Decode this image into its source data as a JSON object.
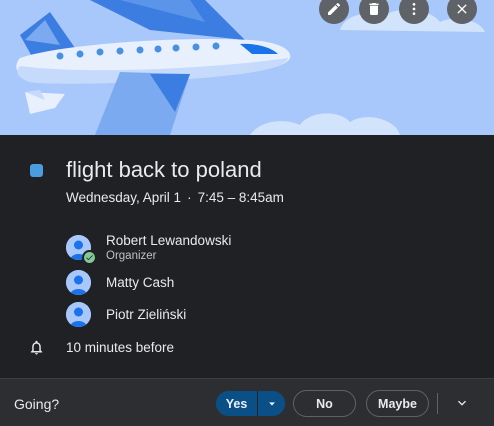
{
  "event": {
    "title": "flight back to poland",
    "date": "Wednesday, April 1",
    "separator": "·",
    "time": "7:45 – 8:45am",
    "color": "#4a9ee0"
  },
  "header_actions": [
    {
      "icon": "pencil-icon",
      "label": "Edit event"
    },
    {
      "icon": "trash-icon",
      "label": "Delete event"
    },
    {
      "icon": "more-vert-icon",
      "label": "Options"
    },
    {
      "icon": "close-icon",
      "label": "Close"
    }
  ],
  "guests": [
    {
      "name": "Robert Lewandowski",
      "role": "Organizer",
      "accepted": true
    },
    {
      "name": "Matty Cash",
      "role": "",
      "accepted": false
    },
    {
      "name": "Piotr Zieliński",
      "role": "",
      "accepted": false
    }
  ],
  "reminder": {
    "icon": "bell-icon",
    "text": "10 minutes before"
  },
  "rsvp": {
    "prompt": "Going?",
    "yes": "Yes",
    "no": "No",
    "maybe": "Maybe",
    "selected": "Yes"
  },
  "colors": {
    "hero_sky": "#a8c7fa",
    "panel": "#202124",
    "footer": "#2d2e31",
    "accent": "#0b4f87"
  }
}
